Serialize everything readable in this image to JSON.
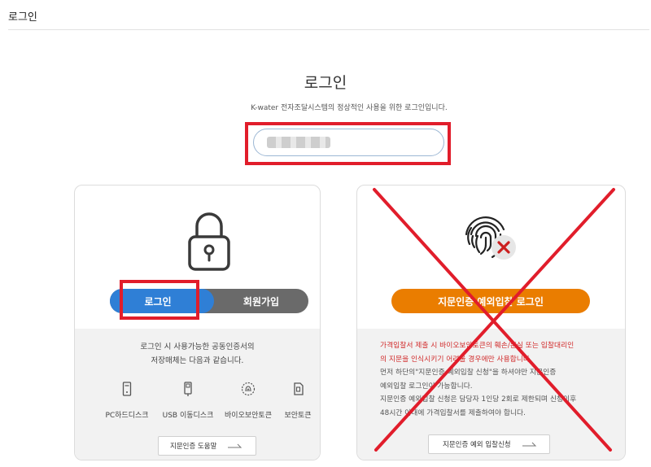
{
  "header": {
    "title": "로그인"
  },
  "main": {
    "title": "로그인",
    "subtitle": "K-water 전자조달시스템의 정상적인 사용을 위한 로그인입니다."
  },
  "id_input": {
    "value": ""
  },
  "cert_login": {
    "tab_login": "로그인",
    "tab_join": "회원가입",
    "description_line1": "로그인 시 사용가능한 공동인증서의",
    "description_line2": "저장매체는 다음과 같습니다.",
    "media": [
      {
        "label": "PC하드디스크",
        "icon": "pc-harddisk-icon"
      },
      {
        "label": "USB 이동디스크",
        "icon": "usb-icon"
      },
      {
        "label": "바이오보안토큰",
        "icon": "bio-token-icon"
      },
      {
        "label": "보안토큰",
        "icon": "security-token-icon"
      }
    ],
    "help_button": "지문인증 도움말"
  },
  "fingerprint_login": {
    "button": "지문인증 예외입찰 로그인",
    "notice_red_line1": "가격입찰서 제출 시 바이오보안토큰의 훼손/분실 또는 입찰대리인",
    "notice_red_line2": "의 지문을 인식시키기 어려울 경우에만 사용합니다.",
    "notice_line3": "먼저 하단의\"지문인증 예외입찰 신청\"을 하셔야만 지문인증",
    "notice_line4": "예외입찰 로그인이 가능합니다.",
    "notice_line5": "지문인증 예외입찰 신청은 담당자 1인당 2회로 제한되며 신청이후",
    "notice_line6": "48시간 이내에 가격입찰서를 제출하여야 합니다.",
    "apply_button": "지문인증 예외 입찰신청"
  },
  "colors": {
    "annotation_red": "#e11d2b",
    "login_blue": "#2f7fd6",
    "join_gray": "#6a6a6a",
    "fingerprint_orange": "#ea7d00",
    "notice_red": "#d12b2b"
  }
}
